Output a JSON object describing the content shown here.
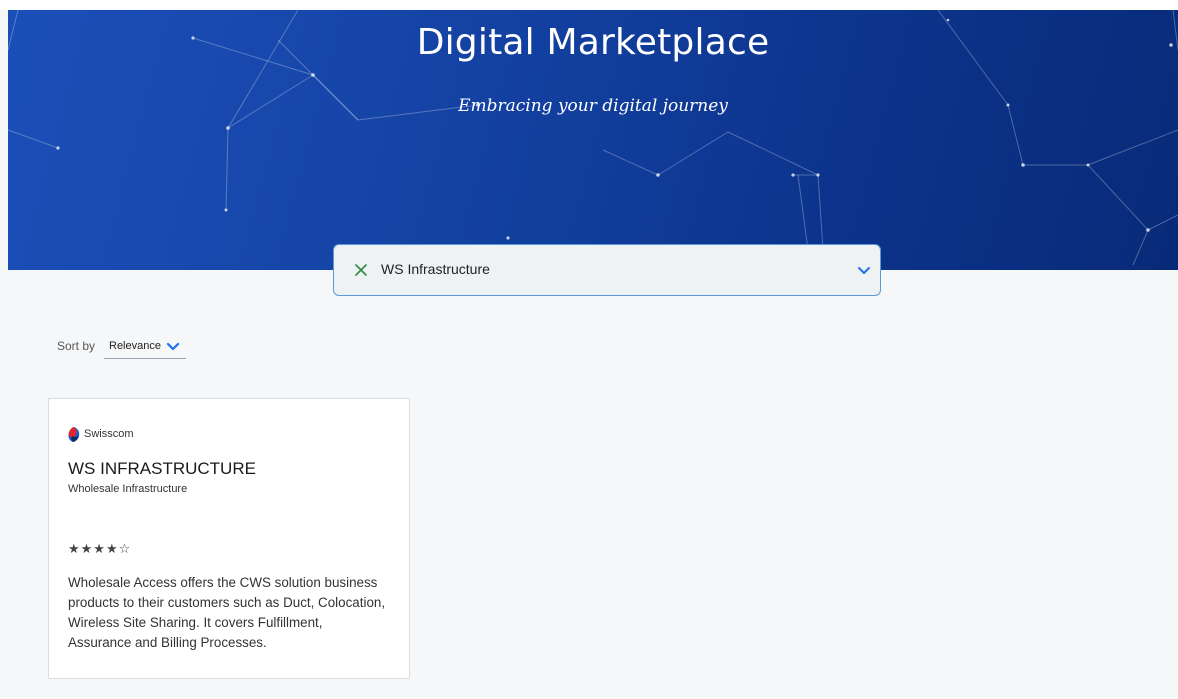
{
  "hero": {
    "title": "Digital Marketplace",
    "subtitle": "Embracing your digital journey"
  },
  "filter": {
    "selected_value": "WS Infrastructure",
    "clear_icon": "close-icon",
    "dropdown_icon": "chevron-down-icon"
  },
  "sort": {
    "label": "Sort by",
    "selected": "Relevance",
    "dropdown_icon": "chevron-down-icon"
  },
  "products": [
    {
      "provider": "Swisscom",
      "provider_icon": "swisscom-logo",
      "title": "WS INFRASTRUCTURE",
      "subtitle": "Wholesale Infrastructure",
      "rating": 4,
      "rating_max": 5,
      "rating_display": "★★★★☆",
      "description": "Wholesale Access offers the CWS solution business products to their customers such as Duct, Colocation, Wireless Site Sharing. It covers Fulfillment, Assurance and Billing Processes."
    }
  ],
  "colors": {
    "hero_start": "#1b4fb8",
    "hero_end": "#082a78",
    "accent_blue": "#1a73e8",
    "clear_green": "#2e8b3e",
    "page_bg": "#f6f7f9"
  }
}
